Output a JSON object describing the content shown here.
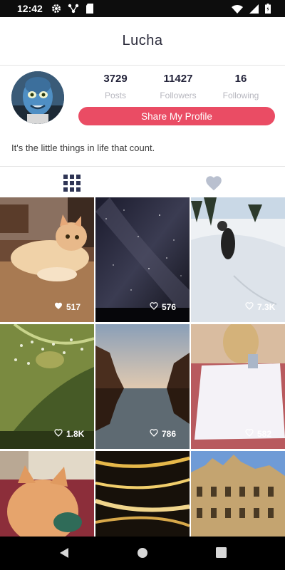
{
  "status_bar": {
    "time": "12:42",
    "left_icons": [
      "gear-icon",
      "network-icon",
      "sd-card-icon"
    ],
    "right_icons": [
      "wifi-icon",
      "signal-icon",
      "battery-icon"
    ]
  },
  "header": {
    "title": "Lucha"
  },
  "profile": {
    "stats": [
      {
        "value": "3729",
        "label": "Posts"
      },
      {
        "value": "11427",
        "label": "Followers"
      },
      {
        "value": "16",
        "label": "Following"
      }
    ],
    "share_label": "Share My Profile",
    "bio": "It's the little things in life that count."
  },
  "tabs": [
    {
      "icon": "grid-icon",
      "active": true
    },
    {
      "icon": "heart-icon",
      "active": false
    }
  ],
  "posts": [
    {
      "likes": "517"
    },
    {
      "likes": "576"
    },
    {
      "likes": "7.3K"
    },
    {
      "likes": "1.8K"
    },
    {
      "likes": "786"
    },
    {
      "likes": "582"
    },
    {
      "likes": ""
    },
    {
      "likes": ""
    },
    {
      "likes": ""
    }
  ],
  "nav": [
    "back-icon",
    "home-icon",
    "recents-icon"
  ],
  "colors": {
    "accent": "#ea4c64",
    "tab_icon": "#2f3555"
  }
}
